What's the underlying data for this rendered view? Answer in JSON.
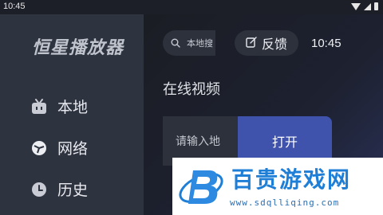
{
  "status_bar": {
    "time": "10:45"
  },
  "sidebar": {
    "app_title": "恒星播放器",
    "items": [
      {
        "label": "本地",
        "icon": "tv-icon"
      },
      {
        "label": "网络",
        "icon": "network-icon"
      },
      {
        "label": "历史",
        "icon": "clock-icon"
      }
    ]
  },
  "header": {
    "search_placeholder": "本地搜",
    "feedback_label": "反馈",
    "clock": "10:45"
  },
  "main": {
    "section_title": "在线视频",
    "url_placeholder": "请输入地",
    "open_label": "打开"
  },
  "watermark": {
    "text": "百贵游戏网",
    "url": "www.sdqlliqing.com"
  },
  "colors": {
    "accent": "#3f53ad",
    "sidebar": "#2e3340",
    "background": "#1c1f27"
  }
}
